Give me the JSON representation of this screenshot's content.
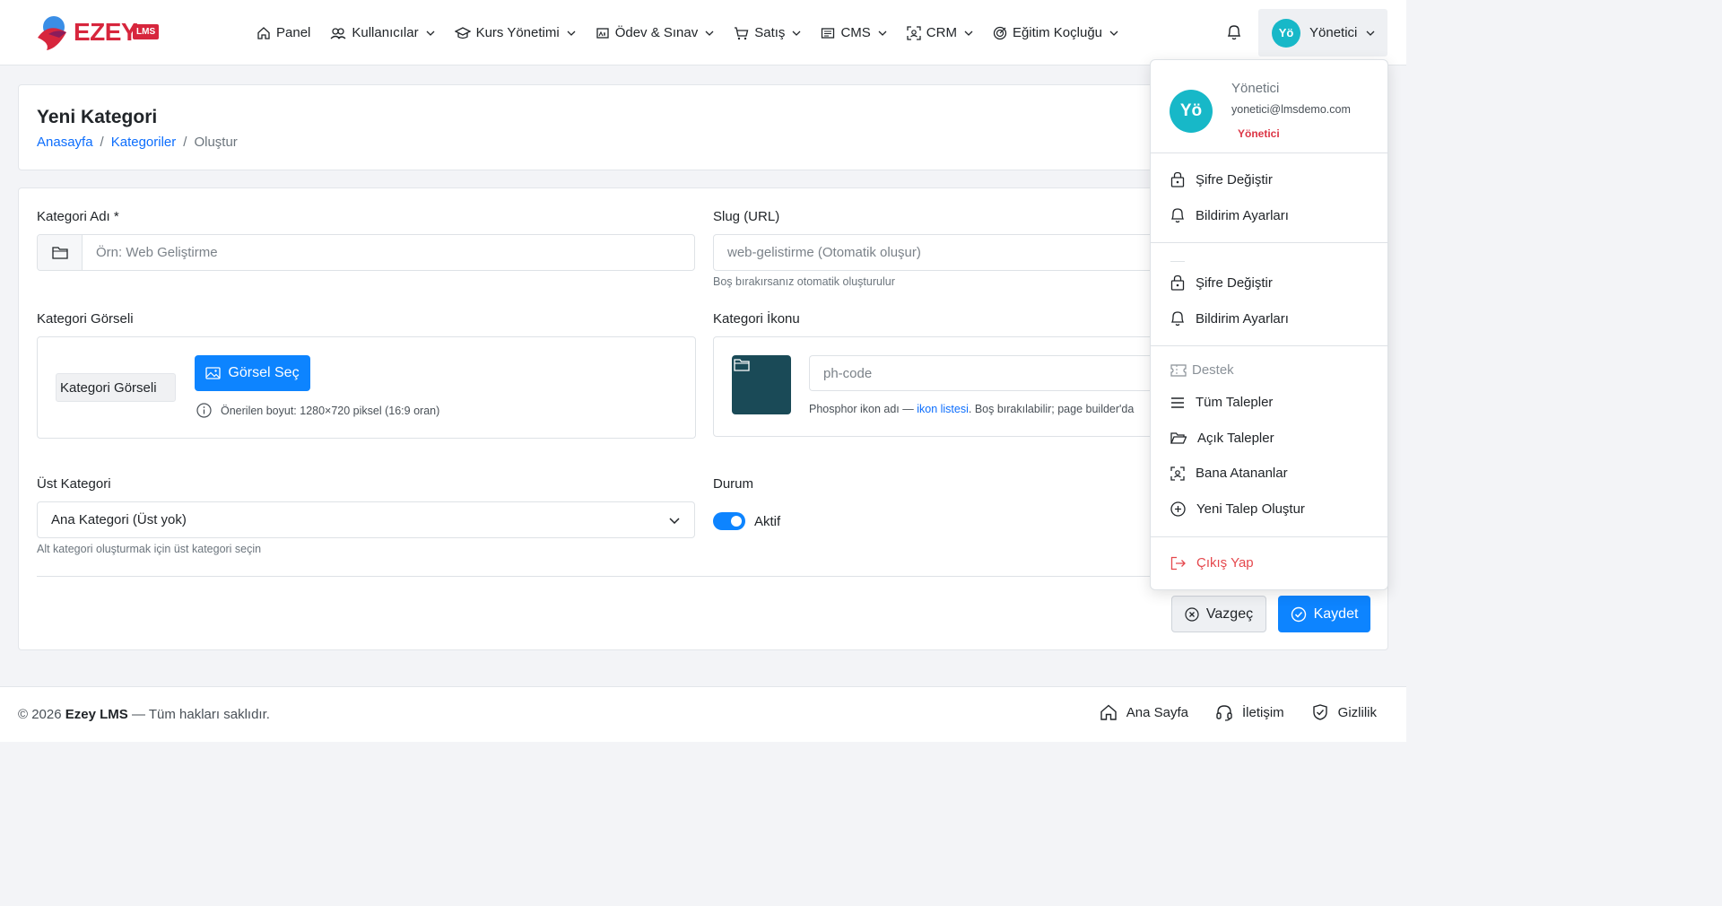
{
  "brand": {
    "name": "EZEY",
    "badge": "LMS",
    "colors": {
      "primary": "#d7263d",
      "accent": "#0d84ff",
      "avatar": "#17b8c8"
    }
  },
  "nav": {
    "items": [
      {
        "label": "Panel",
        "icon": "home-icon"
      },
      {
        "label": "Kullanıcılar",
        "icon": "users-icon"
      },
      {
        "label": "Kurs Yönetimi",
        "icon": "graduation-cap-icon"
      },
      {
        "label": "Ödev & Sınav",
        "icon": "exam-icon"
      },
      {
        "label": "Satış",
        "icon": "cart-icon"
      },
      {
        "label": "CMS",
        "icon": "newspaper-icon"
      },
      {
        "label": "CRM",
        "icon": "user-focus-icon"
      },
      {
        "label": "Eğitim Koçluğu",
        "icon": "target-icon"
      }
    ],
    "user": {
      "initials": "Yö",
      "label": "Yönetici"
    }
  },
  "page": {
    "title": "Yeni Kategori",
    "breadcrumb": {
      "home": "Anasayfa",
      "sep": "/",
      "parent": "Kategoriler",
      "current": "Oluştur"
    }
  },
  "form": {
    "name": {
      "label": "Kategori Adı *",
      "placeholder": "Örn: Web Geliştirme",
      "value": ""
    },
    "slug": {
      "label": "Slug (URL)",
      "placeholder": "web-gelistirme (Otomatik oluşur)",
      "help": "Boş bırakırsanız otomatik oluşturulur"
    },
    "image": {
      "label": "Kategori Görseli",
      "alt": "Kategori Görseli",
      "button": "Görsel Seç",
      "help": "Önerilen boyut: 1280×720 piksel (16:9 oran)"
    },
    "icon": {
      "label": "Kategori İkonu",
      "placeholder": "ph-code",
      "help_prefix": "Phosphor ikon adı — ",
      "help_link": "ikon listesi",
      "help_suffix": ". Boş bırakılabilir; page builder'da"
    },
    "parent": {
      "label": "Üst Kategori",
      "value": "Ana Kategori (Üst yok)",
      "help": "Alt kategori oluşturmak için üst kategori seçin"
    },
    "status": {
      "label": "Durum",
      "value": "Aktif",
      "enabled": true
    },
    "cancel": "Vazgeç",
    "save": "Kaydet"
  },
  "footer": {
    "year": "© 2026",
    "brand": "Ezey LMS",
    "rights": "— Tüm hakları saklıdır.",
    "links": [
      "Ana Sayfa",
      "İletişim",
      "Gizlilik"
    ]
  },
  "dropdown": {
    "initials": "Yö",
    "name": "Yönetici",
    "email": "yonetici@lmsdemo.com",
    "role": "Yönetici",
    "group1": [
      "Şifre Değiştir",
      "Bildirim Ayarları"
    ],
    "group2": [
      "Şifre Değiştir",
      "Bildirim Ayarları"
    ],
    "support_header": "Destek",
    "support": [
      "Tüm Talepler",
      "Açık Talepler",
      "Bana Atananlar",
      "Yeni Talep Oluştur"
    ],
    "logout": "Çıkış Yap"
  }
}
